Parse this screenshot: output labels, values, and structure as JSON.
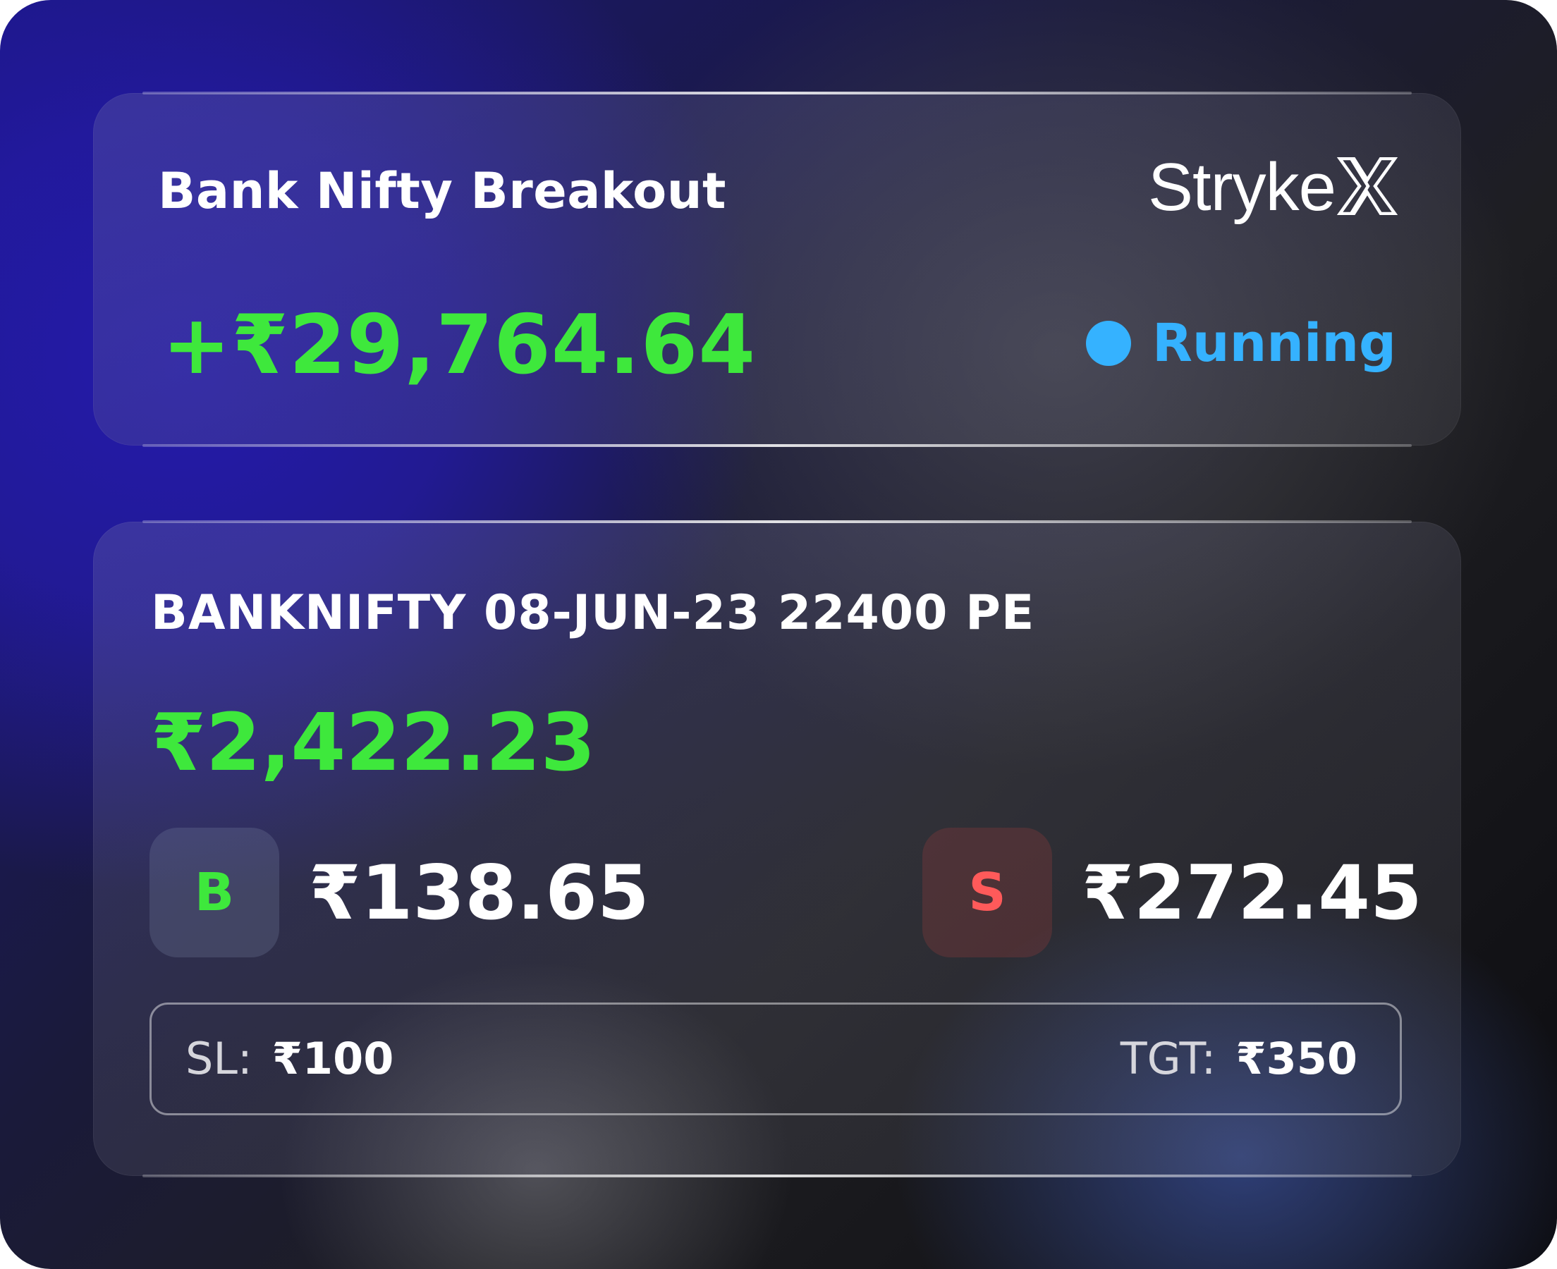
{
  "strategy": {
    "title": "Bank Nifty Breakout",
    "total_pnl": "+₹29,764.64",
    "status_label": "Running",
    "status_color": "#35b2ff"
  },
  "brand": {
    "text": "Stryke",
    "mark": "X"
  },
  "position": {
    "instrument": "BANKNIFTY 08-JUN-23 22400 PE",
    "pnl": "₹2,422.23",
    "buy": {
      "badge": "B",
      "price": "₹138.65"
    },
    "sell": {
      "badge": "S",
      "price": "₹272.45"
    },
    "stop_loss": {
      "label": "SL:",
      "value": "₹100"
    },
    "target": {
      "label": "TGT:",
      "value": "₹350"
    }
  },
  "colors": {
    "profit_green": "#3ee83c",
    "sell_red": "#ff5a5a",
    "running_blue": "#35b2ff"
  }
}
